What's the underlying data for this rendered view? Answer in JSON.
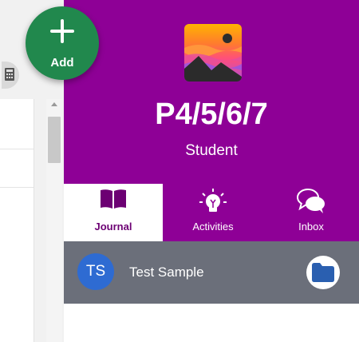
{
  "add_button": {
    "label": "Add"
  },
  "header": {
    "class_name": "P4/5/6/7",
    "role": "Student"
  },
  "tabs": [
    {
      "label": "Journal",
      "icon": "book-icon",
      "active": true
    },
    {
      "label": "Activities",
      "icon": "lightbulb-icon",
      "active": false
    },
    {
      "label": "Inbox",
      "icon": "chat-bubbles-icon",
      "active": false
    }
  ],
  "student": {
    "initials": "TS",
    "name": "Test Sample"
  },
  "colors": {
    "brand_purple": "#8e0096",
    "add_green": "#21884d",
    "row_gray": "#6b6f7a",
    "avatar_blue": "#2e6bd2",
    "folder_blue": "#2a5fb0"
  }
}
